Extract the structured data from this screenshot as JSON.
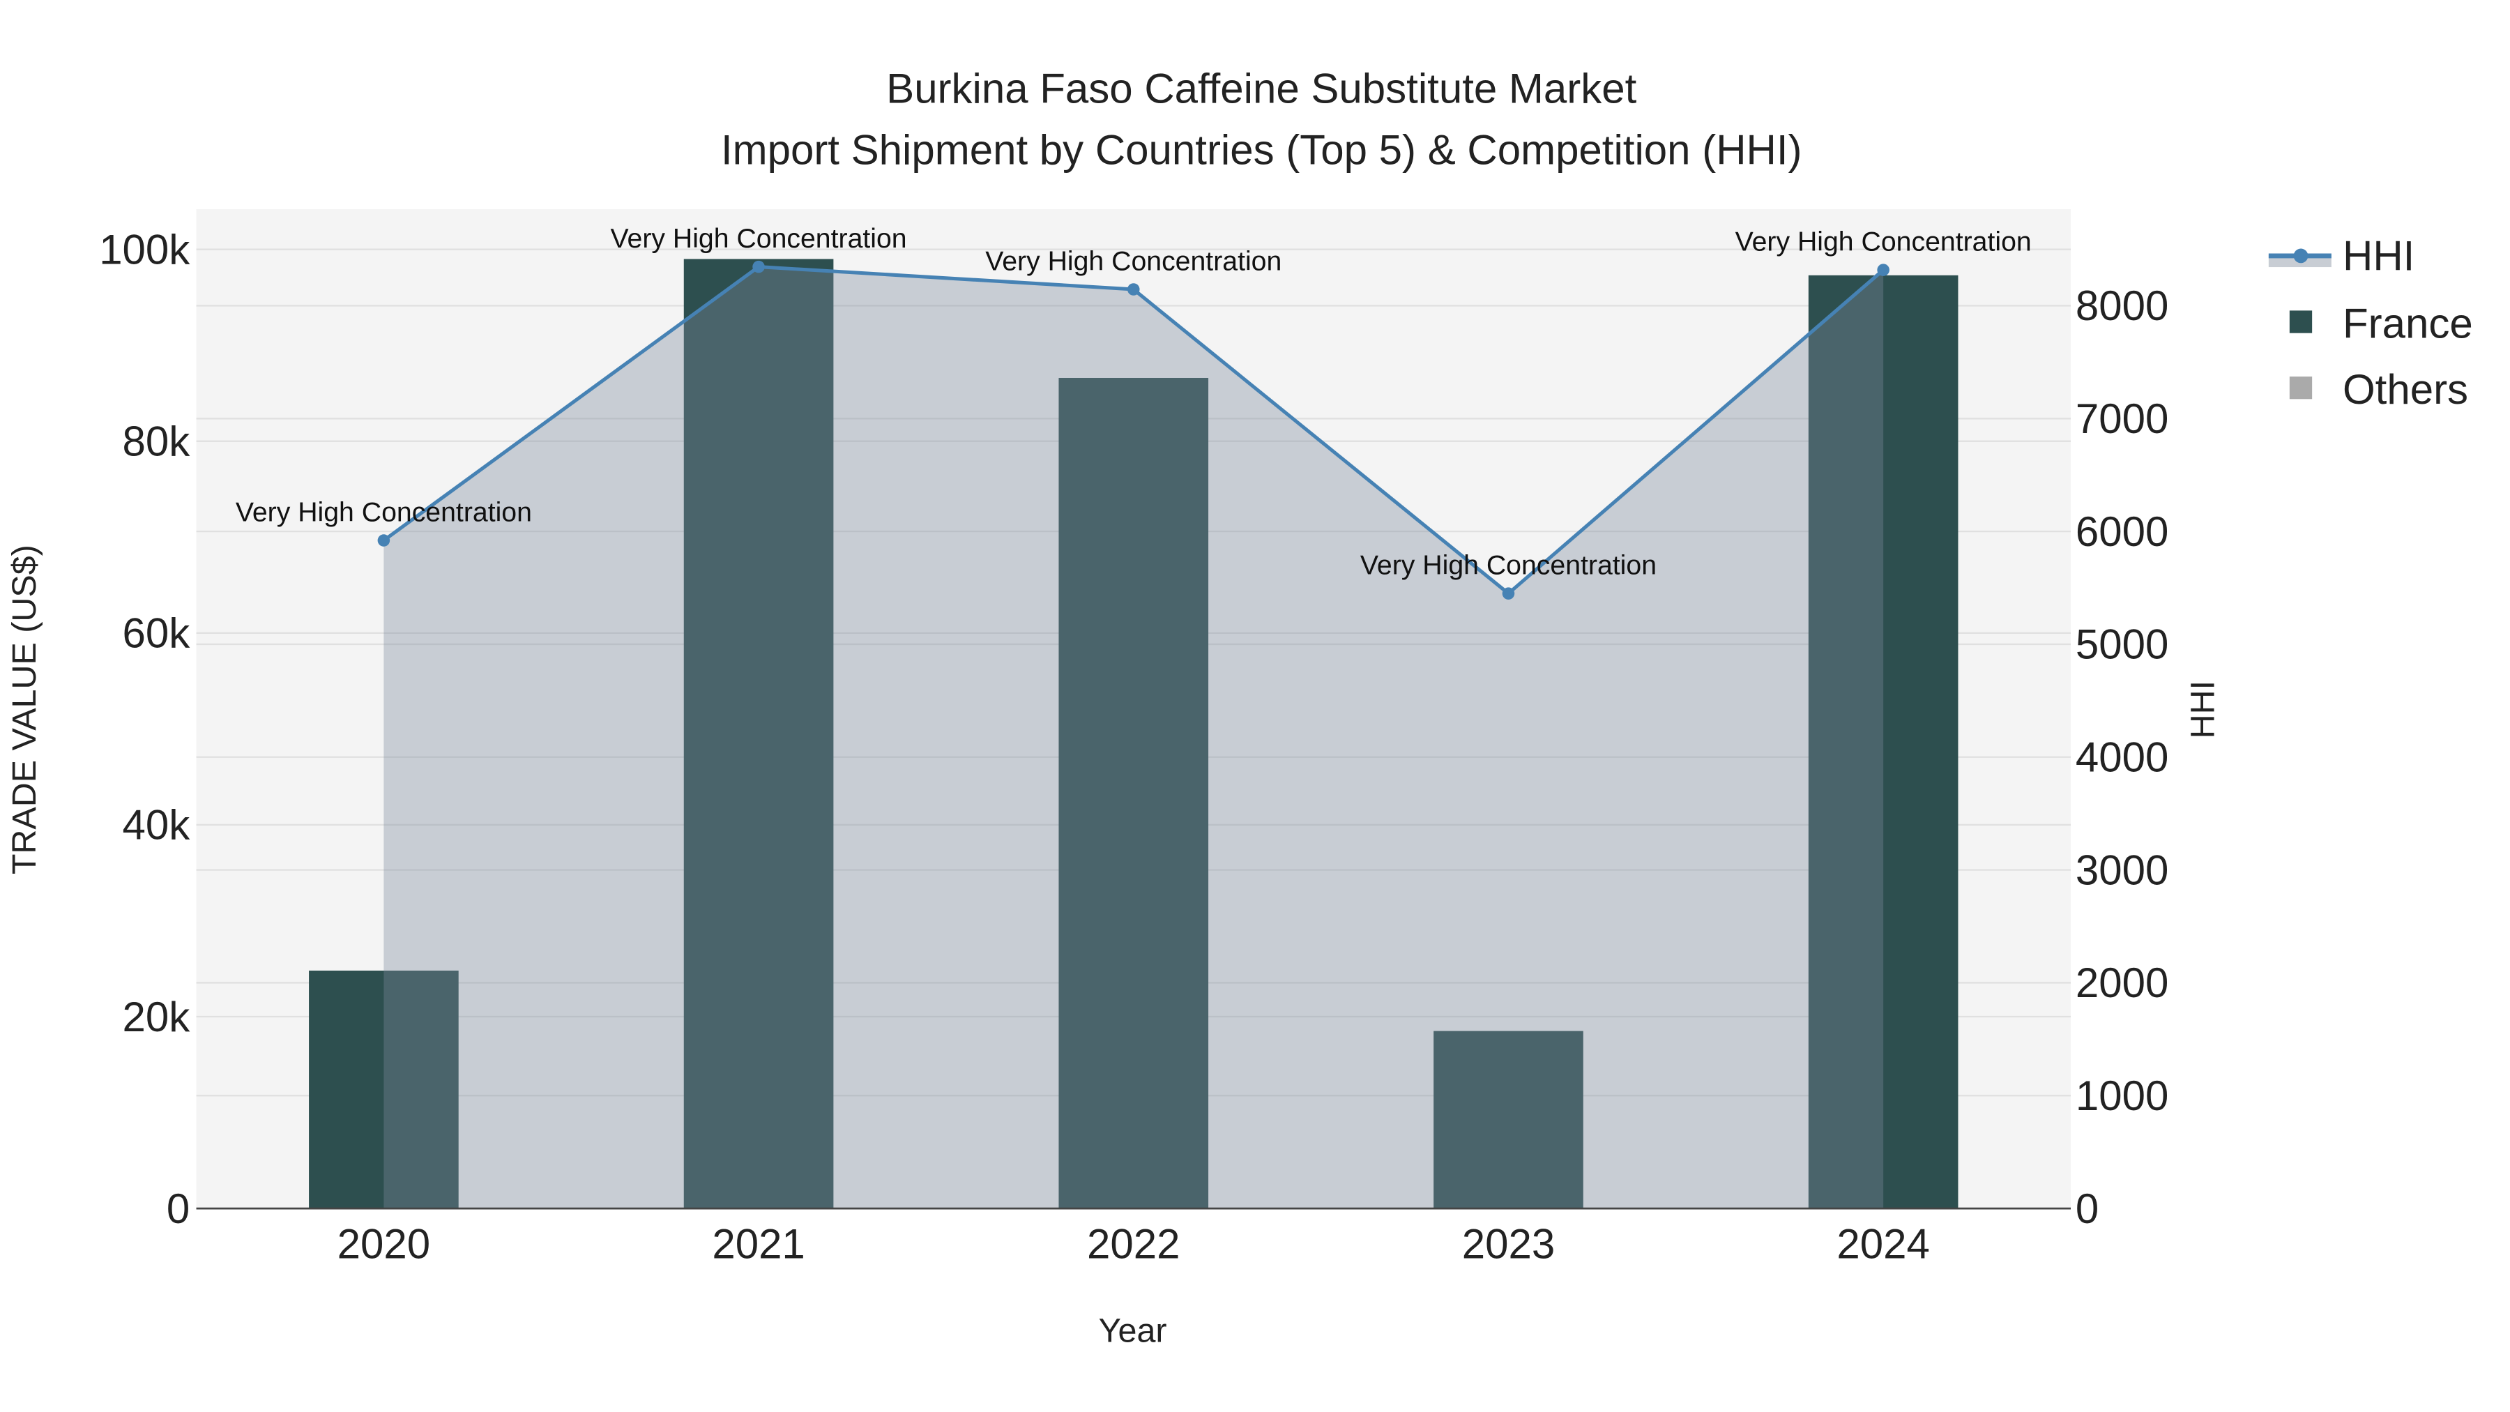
{
  "chart_data": {
    "type": "bar",
    "title": "Burkina Faso Caffeine Substitute Market",
    "subtitle": "Import Shipment by Countries (Top 5) & Competition (HHI)",
    "xlabel": "Year",
    "ylabel": "TRADE VALUE (US$)",
    "y2label": "HHI",
    "categories": [
      "2020",
      "2021",
      "2022",
      "2023",
      "2024"
    ],
    "ylim": [
      0,
      104000
    ],
    "y2lim": [
      0,
      8860
    ],
    "yticks": [
      0,
      20000,
      40000,
      60000,
      80000,
      100000
    ],
    "ytick_labels": [
      "0",
      "20k",
      "40k",
      "60k",
      "80k",
      "100k"
    ],
    "y2ticks": [
      0,
      1000,
      2000,
      3000,
      4000,
      5000,
      6000,
      7000,
      8000
    ],
    "y2tick_labels": [
      "0",
      "1000",
      "2000",
      "3000",
      "4000",
      "5000",
      "6000",
      "7000",
      "8000"
    ],
    "grid": true,
    "legend_position": "right",
    "series": [
      {
        "name": "France",
        "type": "bar",
        "axis": "left",
        "color": "#2d4f4f",
        "values": [
          24800,
          99000,
          86600,
          18500,
          97300
        ]
      },
      {
        "name": "Others",
        "type": "bar",
        "axis": "left",
        "color": "#aaaaaa",
        "values": [
          0,
          0,
          0,
          0,
          0
        ]
      },
      {
        "name": "HHI",
        "type": "line-area",
        "axis": "right",
        "color": "#4682b4",
        "values": [
          5920,
          8345,
          8145,
          5450,
          8317
        ],
        "annotations": [
          "Very High Concentration",
          "Very High Concentration",
          "Very High Concentration",
          "Very High Concentration",
          "Very High Concentration"
        ]
      }
    ],
    "legend": [
      "HHI",
      "France",
      "Others"
    ]
  }
}
